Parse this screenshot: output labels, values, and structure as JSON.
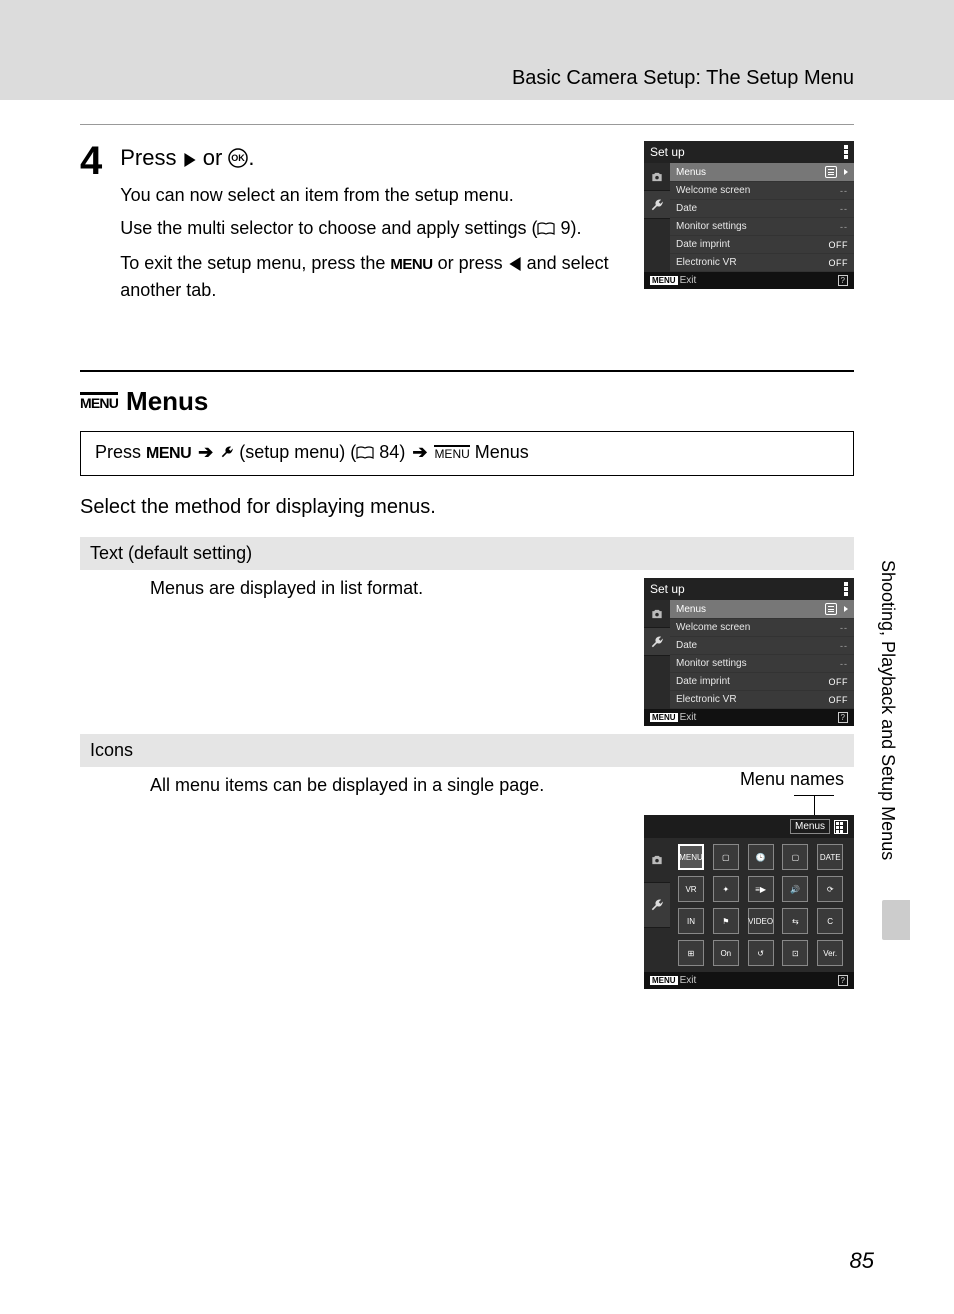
{
  "header": {
    "title": "Basic Camera Setup: The Setup Menu"
  },
  "step4": {
    "number": "4",
    "title_pre": "Press ",
    "title_mid": " or ",
    "title_post": ".",
    "line1": "You can now select an item from the setup menu.",
    "line2_pre": "Use the multi selector to choose and apply settings (",
    "line2_ref": " 9).",
    "line3_pre": "To exit the setup menu, press the ",
    "line3_mid": " or press ",
    "line3_post": " and select another tab."
  },
  "lcd": {
    "title": "Set up",
    "items": [
      {
        "label": "Menus",
        "value": "list",
        "selected": true
      },
      {
        "label": "Welcome screen",
        "value": "--"
      },
      {
        "label": "Date",
        "value": "--"
      },
      {
        "label": "Monitor settings",
        "value": "--"
      },
      {
        "label": "Date imprint",
        "value": "OFF"
      },
      {
        "label": "Electronic VR",
        "value": "OFF"
      }
    ],
    "exit_chip": "MENU",
    "exit_label": "Exit"
  },
  "menus_section": {
    "heading_chip": "MENU",
    "heading": "Menus",
    "path_press": "Press ",
    "path_menu": "MENU",
    "path_setup": " (setup menu) (",
    "path_page": " 84) ",
    "path_end": " Menus",
    "intro": "Select the method for displaying menus."
  },
  "text_option": {
    "heading": "Text (default setting)",
    "body": "Menus are displayed in list format."
  },
  "icons_option": {
    "heading": "Icons",
    "body": "All menu items can be displayed in a single page.",
    "callout": "Menu names",
    "icon_lcd_top": "Menus"
  },
  "side": {
    "label": "Shooting, Playback and Setup Menus"
  },
  "page": {
    "number": "85"
  }
}
